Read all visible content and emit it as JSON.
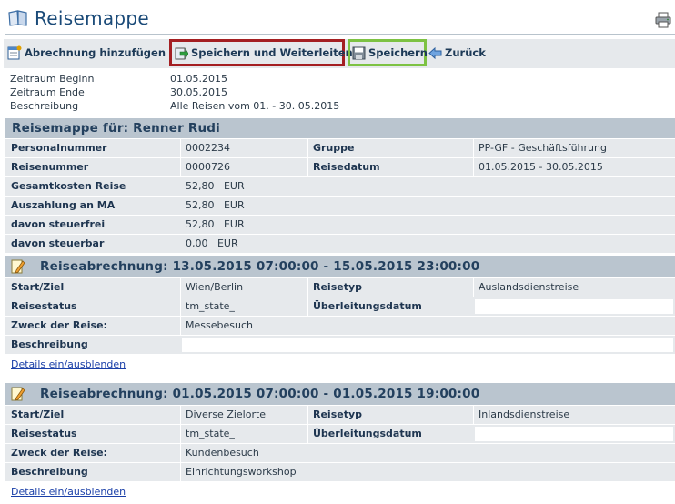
{
  "header": {
    "title": "Reisemappe",
    "book_icon": "book-icon",
    "print_icon": "printer-icon"
  },
  "toolbar": {
    "add_label": "Abrechnung hinzufügen",
    "forward_label": "Speichern und Weiterleiten",
    "save_label": "Speichern",
    "back_label": "Zurück",
    "forward_highlight": "#a41f22",
    "save_highlight": "#7dc243"
  },
  "info": {
    "start_label": "Zeitraum Beginn",
    "start_value": "01.05.2015",
    "end_label": "Zeitraum Ende",
    "end_value": "30.05.2015",
    "desc_label": "Beschreibung",
    "desc_value": "Alle Reisen vom 01. - 30. 05.2015"
  },
  "folder": {
    "heading": "Reisemappe für: Renner Rudi",
    "personalnummer_label": "Personalnummer",
    "personalnummer": "0002234",
    "gruppe_label": "Gruppe",
    "gruppe": "PP-GF - Geschäftsführung",
    "reisenummer_label": "Reisenummer",
    "reisenummer": "0000726",
    "reisedatum_label": "Reisedatum",
    "reisedatum": "01.05.2015 - 30.05.2015",
    "gesamtkosten_label": "Gesamtkosten Reise",
    "gesamtkosten": "52,80   EUR",
    "auszahlung_label": "Auszahlung an MA",
    "auszahlung": "52,80   EUR",
    "steuerfrei_label": "davon steuerfrei",
    "steuerfrei": "52,80   EUR",
    "steuerbar_label": "davon steuerbar",
    "steuerbar": "0,00   EUR"
  },
  "trips": [
    {
      "heading": "Reiseabrechnung: 13.05.2015 07:00:00 - 15.05.2015 23:00:00",
      "start_ziel_label": "Start/Ziel",
      "start_ziel": "Wien/Berlin",
      "reisetyp_label": "Reisetyp",
      "reisetyp": "Auslandsdienstreise",
      "status_label": "Reisestatus",
      "status": "tm_state_",
      "ueberleitung_label": "Überleitungsdatum",
      "ueberleitung": "",
      "zweck_label": "Zweck der Reise:",
      "zweck": "Messebesuch",
      "beschreibung_label": "Beschreibung",
      "beschreibung": "",
      "details_link": "Details ein/ausblenden"
    },
    {
      "heading": "Reiseabrechnung: 01.05.2015 07:00:00 - 01.05.2015 19:00:00",
      "start_ziel_label": "Start/Ziel",
      "start_ziel": "Diverse Zielorte",
      "reisetyp_label": "Reisetyp",
      "reisetyp": "Inlandsdienstreise",
      "status_label": "Reisestatus",
      "status": "tm_state_",
      "ueberleitung_label": "Überleitungsdatum",
      "ueberleitung": "",
      "zweck_label": "Zweck der Reise:",
      "zweck": "Kundenbesuch",
      "beschreibung_label": "Beschreibung",
      "beschreibung": "Einrichtungsworkshop",
      "details_link": "Details ein/ausblenden"
    }
  ]
}
